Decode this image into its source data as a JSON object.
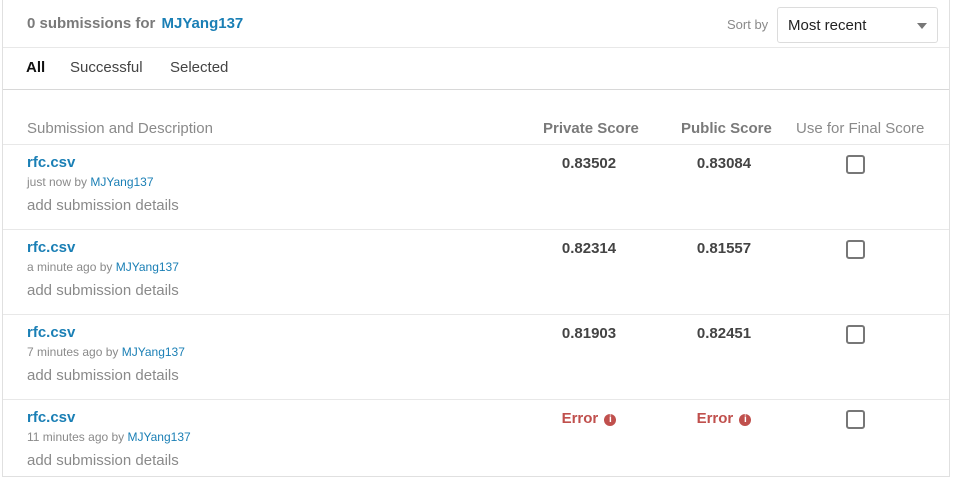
{
  "header": {
    "count_text": "0 submissions for",
    "user": "MJYang137",
    "sort_label": "Sort by",
    "sort_value": "Most recent"
  },
  "tabs": [
    {
      "label": "All",
      "active": true
    },
    {
      "label": "Successful",
      "active": false
    },
    {
      "label": "Selected",
      "active": false
    }
  ],
  "columns": {
    "description": "Submission and Description",
    "private": "Private Score",
    "public": "Public Score",
    "final": "Use for Final Score"
  },
  "submissions": [
    {
      "file": "rfc.csv",
      "time": "just now by",
      "user": "MJYang137",
      "details": "add submission details",
      "private": "0.83502",
      "public": "0.83084"
    },
    {
      "file": "rfc.csv",
      "time": "a minute ago by",
      "user": "MJYang137",
      "details": "add submission details",
      "private": "0.82314",
      "public": "0.81557"
    },
    {
      "file": "rfc.csv",
      "time": "7 minutes ago by",
      "user": "MJYang137",
      "details": "add submission details",
      "private": "0.81903",
      "public": "0.82451"
    },
    {
      "file": "rfc.csv",
      "time": "11 minutes ago by",
      "user": "MJYang137",
      "details": "add submission details",
      "private": "Error",
      "public": "Error"
    }
  ],
  "colors": {
    "link": "#1a7fb5",
    "error": "#c0504d"
  },
  "icons": {
    "error_info": "info-circle-icon",
    "sort_caret": "caret-down-icon"
  }
}
